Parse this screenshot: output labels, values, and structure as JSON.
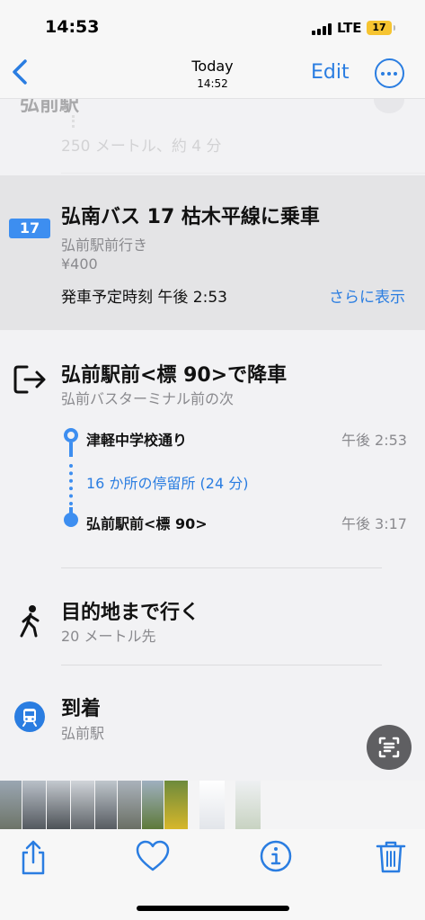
{
  "status_bar": {
    "time": "14:53",
    "network": "LTE",
    "battery": "17"
  },
  "nav": {
    "title": "Today",
    "subtitle": "14:52",
    "edit_label": "Edit"
  },
  "directions": {
    "peek_title": "弘前駅",
    "walk_distance": "250 メートル、約 4 分",
    "bus": {
      "route_number": "17",
      "title": "弘南バス 17 枯木平線に乗車",
      "destination": "弘前駅前行き",
      "fare": "¥400",
      "departure": "発車予定時刻 午後 2:53",
      "more_label": "さらに表示"
    },
    "exit": {
      "title": "弘前駅前<標 90>で降車",
      "subtitle": "弘前バスターミナル前の次"
    },
    "timeline": {
      "start_stop": "津軽中学校通り",
      "start_time": "午後 2:53",
      "stops_summary": "16 か所の停留所 (24 分)",
      "end_stop": "弘前駅前<標 90>",
      "end_time": "午後 3:17"
    },
    "walk": {
      "title": "目的地まで行く",
      "subtitle": "20 メートル先"
    },
    "arrive": {
      "title": "到着",
      "subtitle": "弘前駅"
    }
  },
  "colors": {
    "accent": "#2a7de1",
    "route_badge": "#3d8ef0",
    "battery": "#f6c431"
  },
  "icons": [
    "back-chevron-icon",
    "more-icon",
    "exit-icon",
    "walk-icon",
    "train-icon",
    "live-text-icon",
    "share-icon",
    "heart-icon",
    "info-icon",
    "trash-icon"
  ]
}
